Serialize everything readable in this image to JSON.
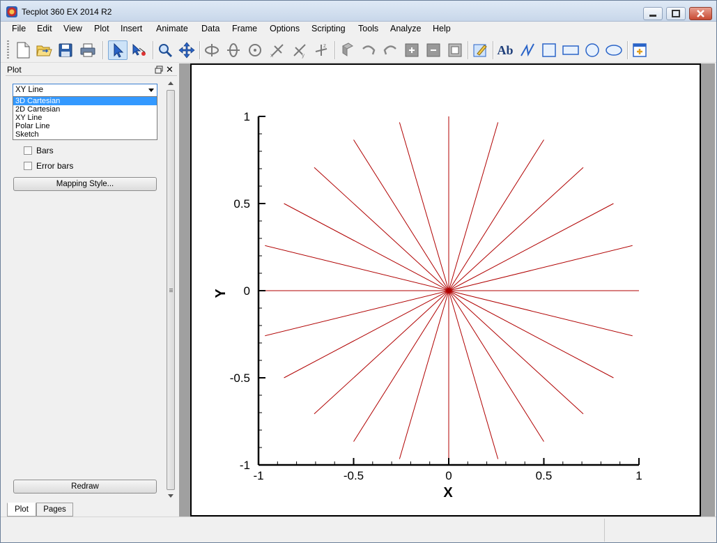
{
  "window": {
    "title": "Tecplot 360 EX 2014 R2"
  },
  "menu": [
    "File",
    "Edit",
    "View",
    "Plot",
    "Insert",
    "Animate",
    "Data",
    "Frame",
    "Options",
    "Scripting",
    "Tools",
    "Analyze",
    "Help"
  ],
  "toolbar": {
    "icons": [
      "new-file",
      "open-file",
      "save",
      "print",
      "selector",
      "adjustor",
      "zoom",
      "translate",
      "rotate-x",
      "rotate-y",
      "rotate-z",
      "rotate-xy",
      "rotate-xz",
      "rotate-yz",
      "probe",
      "rotate-left",
      "rotate-right",
      "zoom-in",
      "zoom-out",
      "fit",
      "edit",
      "text",
      "line",
      "rectangle",
      "square",
      "circle",
      "ellipse",
      "frame"
    ],
    "text_tool_label": "Ab"
  },
  "panel": {
    "title": "Plot",
    "plot_type": {
      "selected": "XY Line",
      "options": [
        "3D Cartesian",
        "2D Cartesian",
        "XY Line",
        "Polar Line",
        "Sketch"
      ],
      "highlighted": "3D Cartesian"
    },
    "checkboxes": [
      {
        "label": "Bars",
        "checked": false
      },
      {
        "label": "Error bars",
        "checked": false
      }
    ],
    "mapping_button": "Mapping Style...",
    "redraw_button": "Redraw",
    "tabs": [
      "Plot",
      "Pages"
    ]
  },
  "chart_data": {
    "type": "line",
    "xlabel": "X",
    "ylabel": "Y",
    "xlim": [
      -1,
      1
    ],
    "ylim": [
      -1,
      1
    ],
    "xticks": [
      "-1",
      "-0.5",
      "0",
      "0.5",
      "1"
    ],
    "yticks": [
      "1",
      "0.5",
      "0",
      "-0.5",
      "-1"
    ],
    "line_color": "#b00000",
    "center": [
      0,
      0
    ],
    "radius": 1,
    "ray_angles_deg": [
      0,
      15,
      30,
      45,
      60,
      75,
      90,
      105,
      120,
      135,
      150,
      165,
      180,
      195,
      210,
      225,
      240,
      255,
      270,
      285,
      300,
      315,
      330,
      345
    ],
    "grid": false
  }
}
